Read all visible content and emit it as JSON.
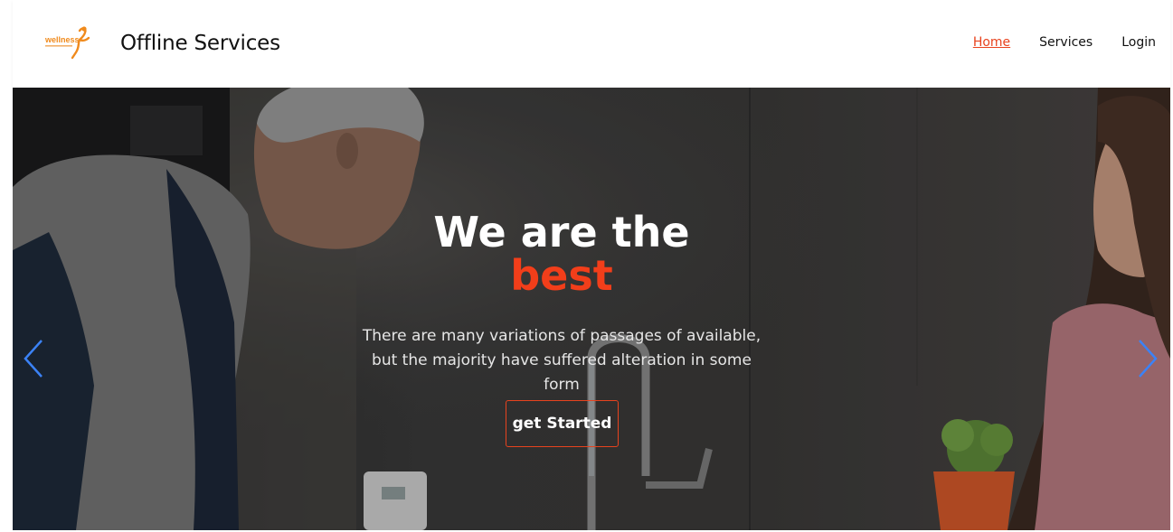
{
  "header": {
    "logo_text": "wellness",
    "brand": "Offline Services",
    "nav": [
      {
        "label": "Home",
        "active": true
      },
      {
        "label": "Services",
        "active": false
      },
      {
        "label": "Login",
        "active": false
      }
    ]
  },
  "hero": {
    "title": "We are the",
    "title_accent": "best",
    "subtitle": "There are many variations of passages of available, but the majority have suffered alteration in some form",
    "cta_label": "get Started",
    "prev_icon": "chevron-left-icon",
    "next_icon": "chevron-right-icon"
  },
  "colors": {
    "accent": "#f23e1a",
    "nav_active": "#e8431e",
    "arrow": "#3b82f6"
  }
}
